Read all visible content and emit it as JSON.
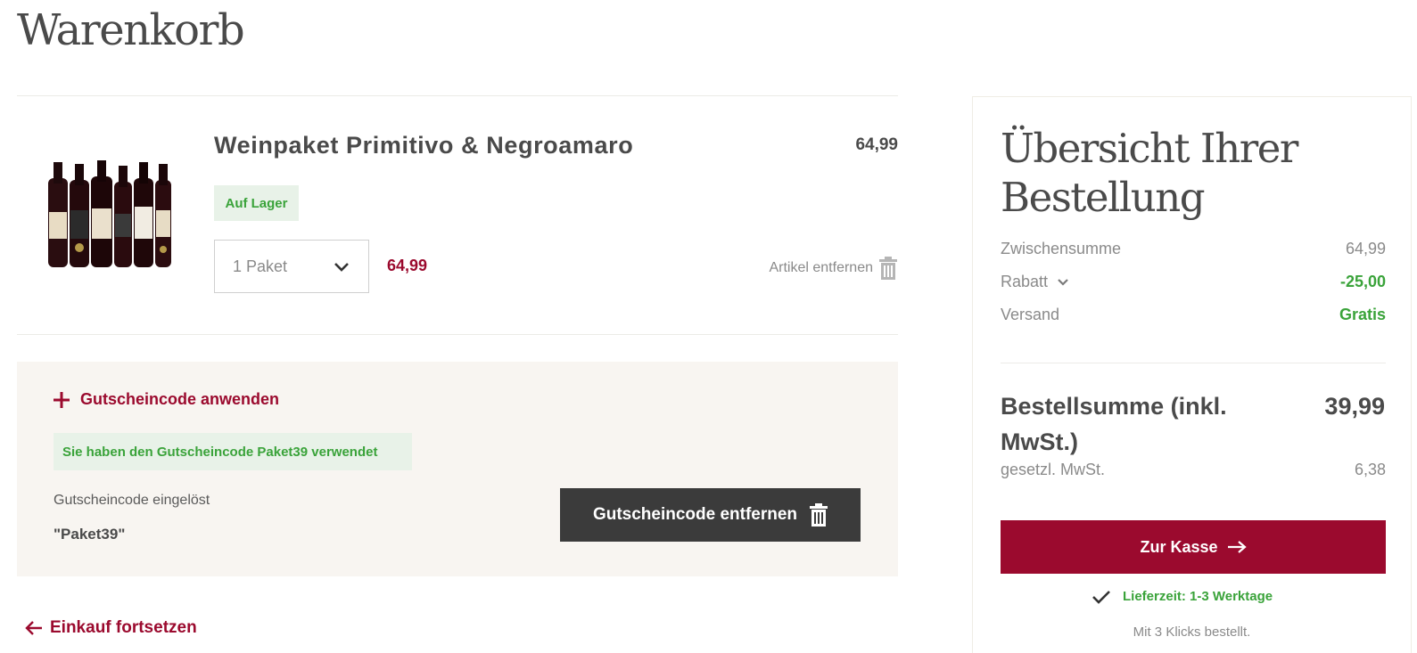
{
  "page": {
    "title": "Warenkorb"
  },
  "cart_item": {
    "name": "Weinpaket Primitivo & Negroamaro",
    "unit_price": "64,99",
    "stock": "Auf Lager",
    "quantity": "1 Paket",
    "line_total": "64,99",
    "remove_label": "Artikel entfernen",
    "image_icon": "wine-bottles-image"
  },
  "coupon": {
    "toggle_label": "Gutscheincode anwenden",
    "success_message": "Sie haben den Gutscheincode Paket39 verwendet",
    "redeemed_label": "Gutscheincode eingelöst",
    "code": "\"Paket39\"",
    "remove_button": "Gutscheincode entfernen"
  },
  "continue_shopping": "Einkauf fortsetzen",
  "summary": {
    "title": "Übersicht Ihrer Bestellung",
    "rows": [
      {
        "label": "Zwischensumme",
        "value": "64,99"
      },
      {
        "label": "Rabatt",
        "value": "-25,00"
      },
      {
        "label": "Versand",
        "value": "Gratis"
      }
    ],
    "total_label": "Bestellsumme (inkl. MwSt.)",
    "total_value": "39,99",
    "vat_label": "gesetzl. MwSt.",
    "vat_value": "6,38",
    "checkout_button": "Zur Kasse",
    "delivery_time": "Lieferzeit: 1-3 Werktage",
    "clicks_note": "Mit 3 Klicks bestellt."
  },
  "colors": {
    "accent": "#9b0a2e",
    "success": "#3aa33a",
    "dark_button": "#3b3b3b",
    "coupon_bg": "#f8f5f1"
  }
}
